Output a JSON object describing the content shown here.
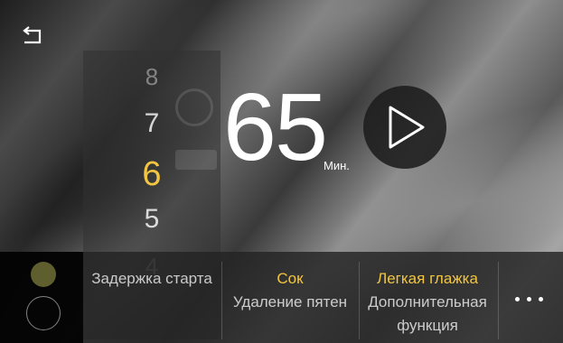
{
  "time": {
    "value": "65",
    "unit": "Мин."
  },
  "wheel": {
    "numbers": [
      "8",
      "7",
      "6",
      "5",
      "4"
    ],
    "selected": "6"
  },
  "options": [
    {
      "value": "",
      "label": "Задержка старта"
    },
    {
      "value": "Сок",
      "label": "Удаление пятен"
    },
    {
      "value": "Легкая глажка",
      "label": "Дополнительная функция"
    }
  ],
  "icons": {
    "back": "back-arrow-icon",
    "play": "play-icon",
    "more": "more-icon"
  },
  "colors": {
    "accent": "#f2c640",
    "text": "#ffffff",
    "panel": "#232323"
  }
}
